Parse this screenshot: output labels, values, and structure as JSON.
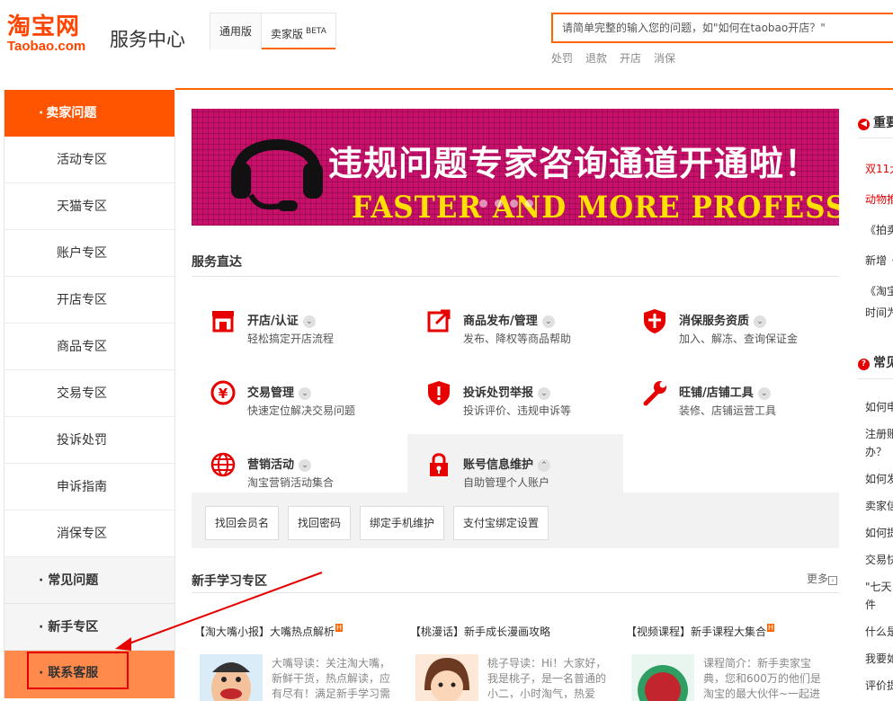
{
  "header": {
    "logo_cn": "淘宝网",
    "logo_en": "Taobao.com",
    "site_title": "服务中心",
    "version_tabs": [
      {
        "label": "通用版"
      },
      {
        "label": "卖家版",
        "badge": "BETA"
      }
    ],
    "search_placeholder": "请简单完整的输入您的问题，如\"如何在taobao开店？\"",
    "hotwords": [
      "处罚",
      "退款",
      "开店",
      "消保"
    ]
  },
  "sidebar": {
    "section_seller": "卖家问题",
    "items": [
      "活动专区",
      "天猫专区",
      "账户专区",
      "开店专区",
      "商品专区",
      "交易专区",
      "投诉处罚",
      "申诉指南",
      "消保专区"
    ],
    "section_faq": "常见问题",
    "section_newbie": "新手专区",
    "section_contact": "联系客服",
    "bullet": "·"
  },
  "banner": {
    "title": "违规问题专家咨询通道开通啦",
    "subtitle": "FASTER AND MORE PROFESSIONAL",
    "title_suffix": "！"
  },
  "services": {
    "section_title": "服务直达",
    "chevron_down": "⌄",
    "chevron_up": "⌃",
    "items": [
      {
        "title": "开店/认证",
        "desc": "轻松搞定开店流程"
      },
      {
        "title": "商品发布/管理",
        "desc": "发布、降权等商品帮助"
      },
      {
        "title": "消保服务资质",
        "desc": "加入、解冻、查询保证金"
      },
      {
        "title": "交易管理",
        "desc": "快速定位解决交易问题"
      },
      {
        "title": "投诉处罚举报",
        "desc": "投诉评价、违规申诉等"
      },
      {
        "title": "旺铺/店铺工具",
        "desc": "装修、店铺运营工具"
      },
      {
        "title": "营销活动",
        "desc": "淘宝营销活动集合"
      },
      {
        "title": "账号信息维护",
        "desc": "自助管理个人账户"
      }
    ],
    "sub_buttons": [
      "找回会员名",
      "找回密码",
      "绑定手机维护",
      "支付宝绑定设置"
    ]
  },
  "learning": {
    "section_title": "新手学习专区",
    "more": "更多",
    "more_icon": "›",
    "hot_badge": "H",
    "articles": [
      {
        "title": "【淘大嘴小报】大嘴热点解析",
        "desc": "大嘴导读：关注淘大嘴，新鲜干货，热点解读，应有尽有！满足新手学习需"
      },
      {
        "title": "【桃漫话】新手成长漫画攻略",
        "desc": "桃子导读：Hi！大家好，我是桃子，是一名普通的小二，小时淘气，热爱"
      },
      {
        "title": "【视频课程】新手课程大集合",
        "desc": "课程简介：新手卖家宝典，您和600万的他们是淘宝的最大伙伴~一起进"
      }
    ]
  },
  "right": {
    "heading1": "重要",
    "items1": [
      "双11大",
      "动物推",
      "《拍卖",
      "新增《",
      "《淘宝",
      "时间为"
    ],
    "heading2": "常见",
    "items2": [
      "如何申",
      "注册账",
      "办？",
      "如何发",
      "卖家信",
      "如何提",
      "交易快",
      "\"七天",
      "件",
      "什么是",
      "我要如",
      "评价提"
    ],
    "icon1": "◀",
    "icon2": "?"
  },
  "colors": {
    "accent": "#ff5500",
    "banner_bg": "#c8106a",
    "banner_sub": "#ffe000",
    "icon_red": "#e60000"
  }
}
